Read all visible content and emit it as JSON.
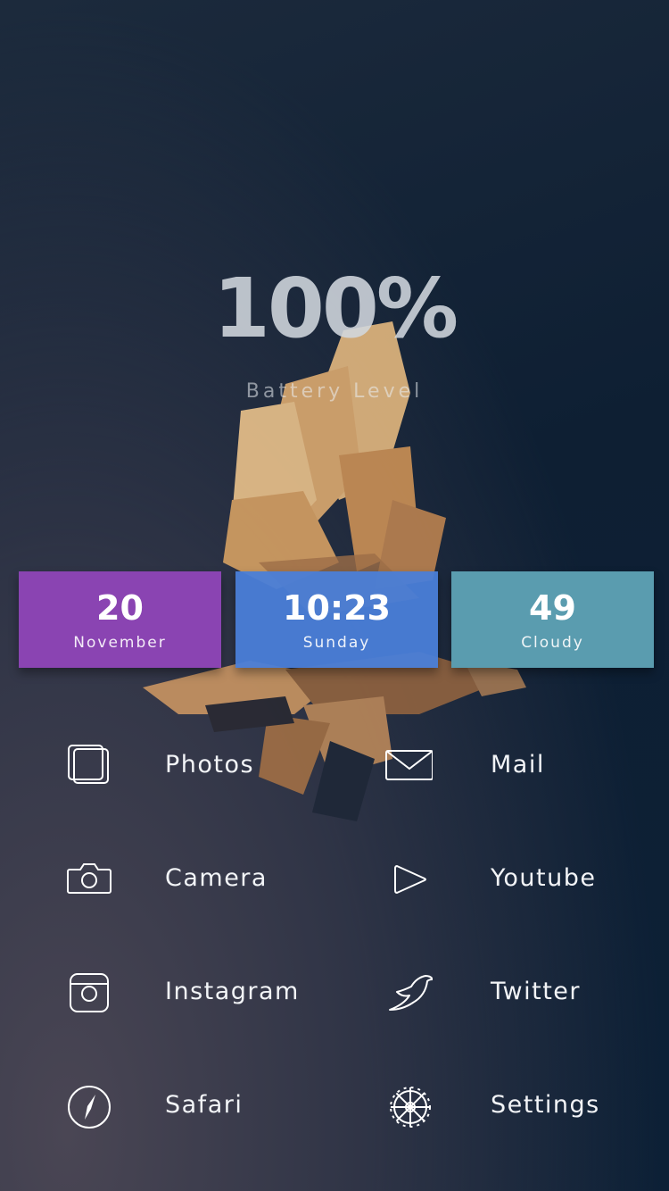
{
  "battery": {
    "percent": "100%",
    "label": "Battery Level"
  },
  "tiles": [
    {
      "value": "20",
      "label": "November",
      "color": "#8a44b2"
    },
    {
      "value": "10:23",
      "label": "Sunday",
      "color": "#4a7ed8"
    },
    {
      "value": "49",
      "label": "Cloudy",
      "color": "#5a9caf"
    }
  ],
  "apps": [
    {
      "label": "Photos",
      "icon": "photos-icon"
    },
    {
      "label": "Mail",
      "icon": "mail-icon"
    },
    {
      "label": "Camera",
      "icon": "camera-icon"
    },
    {
      "label": "Youtube",
      "icon": "play-icon"
    },
    {
      "label": "Instagram",
      "icon": "instagram-icon"
    },
    {
      "label": "Twitter",
      "icon": "bird-icon"
    },
    {
      "label": "Safari",
      "icon": "compass-icon"
    },
    {
      "label": "Settings",
      "icon": "gear-icon"
    }
  ]
}
